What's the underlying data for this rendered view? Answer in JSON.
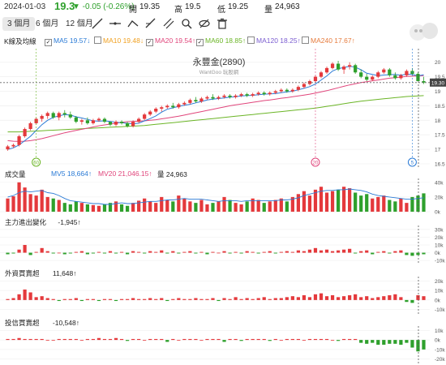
{
  "header": {
    "date": "2024-01-03",
    "price": "19.3",
    "change": "▼ -0.05 (-0.26%)",
    "open_label": "開",
    "open": "19.35",
    "high_label": "高",
    "high": "19.5",
    "low_label": "低",
    "low": "19.25",
    "vol_label": "量",
    "volume": "24,963"
  },
  "toolbar": {
    "ranges": [
      "3 個月",
      "6 個月",
      "12 個月"
    ],
    "active_range": "3 個月",
    "tools": [
      "line-tool-icon",
      "horizontal-line-icon",
      "polyline-icon",
      "measure-icon",
      "channel-icon",
      "zoom-icon",
      "eye-off-icon",
      "trash-icon"
    ]
  },
  "legend": {
    "title": "K線及均線",
    "items": [
      {
        "label": "MA5 19.57↓",
        "color": "#2b7bd6",
        "checked": true
      },
      {
        "label": "MA10 19.48↓",
        "color": "#f0a020",
        "checked": false
      },
      {
        "label": "MA20 19.54↑",
        "color": "#e0457b",
        "checked": true
      },
      {
        "label": "MA60 18.85↑",
        "color": "#6bb526",
        "checked": true
      },
      {
        "label": "MA120 18.25↑",
        "color": "#7a5cd0",
        "checked": false
      },
      {
        "label": "MA240 17.67↑",
        "color": "#e67b3c",
        "checked": false
      }
    ]
  },
  "main_chart": {
    "title": "永豐金(2890)",
    "subtitle": "WantGoo 玩股網",
    "y_ticks": [
      "20",
      "19.5",
      "19",
      "18.5",
      "18",
      "17.5",
      "17",
      "16.5"
    ],
    "last_price_tag": "19.30",
    "markers": [
      "60",
      "20",
      "5"
    ],
    "colors": {
      "up": "#e4393c",
      "down": "#2ea02c"
    }
  },
  "volume_panel": {
    "title": "成交量",
    "mv5": "MV5 18,664↑",
    "mv20": "MV20 21,046.15↑",
    "vol": "量 24,963",
    "y_ticks": [
      "40k",
      "20k",
      "0k"
    ]
  },
  "net_flow_panel": {
    "title": "主力進出變化",
    "value": "-1,945↑",
    "y_ticks": [
      "30k",
      "20k",
      "10k",
      "0k",
      "-10k"
    ]
  },
  "foreign_panel": {
    "title": "外資買賣超",
    "value": "11,648↑",
    "y_ticks": [
      "20k",
      "10k",
      "0k",
      "-10k"
    ]
  },
  "trust_panel": {
    "title": "投信買賣超",
    "value": "-10,548↑",
    "y_ticks": [
      "10k",
      "0k",
      "-10k",
      "-20k"
    ]
  },
  "chart_data": {
    "type": "candlestick",
    "candles": [
      [
        17.0,
        17.15,
        16.95,
        17.1
      ],
      [
        17.1,
        17.2,
        17.05,
        17.15
      ],
      [
        17.15,
        17.5,
        17.1,
        17.45
      ],
      [
        17.45,
        17.75,
        17.4,
        17.7
      ],
      [
        17.7,
        17.95,
        17.65,
        17.9
      ],
      [
        17.9,
        18.1,
        17.85,
        18.05
      ],
      [
        18.05,
        18.2,
        17.95,
        18.15
      ],
      [
        18.15,
        18.3,
        18.05,
        18.25
      ],
      [
        18.25,
        18.3,
        18.05,
        18.1
      ],
      [
        18.1,
        18.3,
        18.0,
        18.25
      ],
      [
        18.25,
        18.35,
        18.1,
        18.2
      ],
      [
        18.2,
        18.3,
        18.05,
        18.1
      ],
      [
        18.1,
        18.15,
        17.9,
        17.95
      ],
      [
        17.95,
        18.05,
        17.85,
        18.0
      ],
      [
        18.0,
        18.1,
        17.85,
        17.9
      ],
      [
        17.9,
        18.05,
        17.85,
        18.0
      ],
      [
        18.0,
        18.1,
        17.95,
        18.05
      ],
      [
        18.05,
        18.1,
        17.9,
        17.95
      ],
      [
        17.95,
        17.95,
        17.8,
        17.85
      ],
      [
        17.85,
        18.0,
        17.8,
        17.95
      ],
      [
        17.95,
        18.0,
        17.85,
        17.9
      ],
      [
        17.9,
        17.95,
        17.75,
        17.8
      ],
      [
        17.8,
        18.0,
        17.75,
        17.95
      ],
      [
        17.95,
        18.1,
        17.9,
        18.05
      ],
      [
        18.05,
        18.25,
        18.0,
        18.2
      ],
      [
        18.2,
        18.35,
        18.15,
        18.3
      ],
      [
        18.3,
        18.45,
        18.25,
        18.4
      ],
      [
        18.4,
        18.5,
        18.3,
        18.45
      ],
      [
        18.45,
        18.55,
        18.4,
        18.5
      ],
      [
        18.5,
        18.6,
        18.4,
        18.45
      ],
      [
        18.45,
        18.6,
        18.4,
        18.55
      ],
      [
        18.55,
        18.65,
        18.5,
        18.6
      ],
      [
        18.6,
        18.75,
        18.55,
        18.7
      ],
      [
        18.7,
        18.8,
        18.6,
        18.65
      ],
      [
        18.65,
        18.8,
        18.6,
        18.75
      ],
      [
        18.75,
        18.85,
        18.7,
        18.8
      ],
      [
        18.8,
        18.9,
        18.7,
        18.75
      ],
      [
        18.75,
        18.85,
        18.7,
        18.8
      ],
      [
        18.8,
        18.9,
        18.75,
        18.85
      ],
      [
        18.85,
        18.9,
        18.75,
        18.8
      ],
      [
        18.8,
        18.9,
        18.75,
        18.85
      ],
      [
        18.85,
        18.95,
        18.8,
        18.9
      ],
      [
        18.9,
        18.95,
        18.8,
        18.85
      ],
      [
        18.85,
        18.95,
        18.8,
        18.9
      ],
      [
        18.9,
        19.0,
        18.85,
        18.95
      ],
      [
        18.95,
        19.0,
        18.85,
        18.9
      ],
      [
        18.9,
        19.0,
        18.85,
        18.95
      ],
      [
        18.95,
        19.05,
        18.9,
        19.0
      ],
      [
        19.0,
        19.1,
        18.95,
        19.05
      ],
      [
        19.05,
        19.1,
        18.95,
        19.0
      ],
      [
        19.0,
        19.1,
        18.95,
        19.05
      ],
      [
        19.05,
        19.2,
        19.0,
        19.15
      ],
      [
        19.15,
        19.3,
        19.1,
        19.25
      ],
      [
        19.25,
        19.4,
        19.2,
        19.35
      ],
      [
        19.35,
        19.55,
        19.3,
        19.5
      ],
      [
        19.5,
        19.7,
        19.45,
        19.65
      ],
      [
        19.65,
        19.85,
        19.6,
        19.8
      ],
      [
        19.8,
        20.0,
        19.75,
        19.95
      ],
      [
        19.95,
        20.05,
        19.7,
        19.75
      ],
      [
        19.75,
        19.9,
        19.6,
        19.85
      ],
      [
        19.85,
        20.0,
        19.75,
        19.9
      ],
      [
        19.9,
        19.95,
        19.6,
        19.65
      ],
      [
        19.65,
        19.75,
        19.45,
        19.5
      ],
      [
        19.5,
        19.6,
        19.35,
        19.4
      ],
      [
        19.4,
        19.55,
        19.35,
        19.5
      ],
      [
        19.5,
        19.7,
        19.45,
        19.65
      ],
      [
        19.65,
        19.8,
        19.6,
        19.75
      ],
      [
        19.75,
        19.8,
        19.5,
        19.55
      ],
      [
        19.55,
        19.65,
        19.4,
        19.45
      ],
      [
        19.45,
        19.6,
        19.4,
        19.55
      ],
      [
        19.55,
        19.75,
        19.5,
        19.7
      ],
      [
        19.7,
        19.8,
        19.55,
        19.6
      ],
      [
        19.6,
        19.65,
        19.35,
        19.35
      ],
      [
        19.35,
        19.5,
        19.25,
        19.3
      ]
    ],
    "ma5": [
      17.0,
      17.05,
      17.15,
      17.3,
      17.45,
      17.65,
      17.85,
      18.0,
      18.1,
      18.15,
      18.2,
      18.18,
      18.12,
      18.08,
      18.03,
      17.98,
      17.97,
      17.98,
      17.96,
      17.93,
      17.92,
      17.89,
      17.88,
      17.9,
      17.98,
      18.06,
      18.15,
      18.28,
      18.38,
      18.43,
      18.48,
      18.52,
      18.55,
      18.6,
      18.65,
      18.7,
      18.73,
      18.75,
      18.77,
      18.8,
      18.81,
      18.84,
      18.85,
      18.86,
      18.88,
      18.9,
      18.91,
      18.92,
      18.95,
      18.98,
      19.0,
      19.05,
      19.1,
      19.16,
      19.25,
      19.39,
      19.53,
      19.7,
      19.78,
      19.82,
      19.86,
      19.83,
      19.74,
      19.62,
      19.58,
      19.54,
      19.56,
      19.57,
      19.58,
      19.55,
      19.59,
      19.58,
      19.53,
      19.57
    ],
    "ma20": [
      17.3,
      17.28,
      17.27,
      17.28,
      17.3,
      17.33,
      17.37,
      17.42,
      17.47,
      17.52,
      17.57,
      17.61,
      17.65,
      17.69,
      17.73,
      17.77,
      17.81,
      17.84,
      17.87,
      17.9,
      17.93,
      17.95,
      17.96,
      17.97,
      17.98,
      18.0,
      18.02,
      18.05,
      18.08,
      18.11,
      18.14,
      18.18,
      18.22,
      18.26,
      18.3,
      18.34,
      18.38,
      18.42,
      18.46,
      18.5,
      18.53,
      18.56,
      18.59,
      18.62,
      18.65,
      18.68,
      18.7,
      18.73,
      18.76,
      18.78,
      18.81,
      18.84,
      18.87,
      18.9,
      18.94,
      18.98,
      19.02,
      19.07,
      19.12,
      19.17,
      19.22,
      19.26,
      19.3,
      19.33,
      19.36,
      19.39,
      19.42,
      19.45,
      19.47,
      19.49,
      19.51,
      19.52,
      19.53,
      19.54
    ],
    "ma60": [
      17.6,
      17.6,
      17.6,
      17.61,
      17.62,
      17.63,
      17.64,
      17.65,
      17.66,
      17.67,
      17.68,
      17.69,
      17.7,
      17.71,
      17.72,
      17.73,
      17.74,
      17.75,
      17.76,
      17.77,
      17.78,
      17.79,
      17.8,
      17.81,
      17.82,
      17.84,
      17.86,
      17.88,
      17.9,
      17.92,
      17.94,
      17.96,
      17.98,
      18.0,
      18.02,
      18.04,
      18.06,
      18.08,
      18.1,
      18.12,
      18.14,
      18.16,
      18.18,
      18.2,
      18.22,
      18.24,
      18.26,
      18.28,
      18.3,
      18.32,
      18.34,
      18.36,
      18.38,
      18.4,
      18.42,
      18.45,
      18.48,
      18.51,
      18.54,
      18.57,
      18.6,
      18.63,
      18.66,
      18.68,
      18.7,
      18.72,
      18.74,
      18.76,
      18.78,
      18.8,
      18.82,
      18.83,
      18.84,
      18.85
    ],
    "volume": [
      18,
      21,
      40,
      33,
      24,
      22,
      30,
      20,
      18,
      16,
      12,
      10,
      14,
      12,
      10,
      9,
      8,
      10,
      12,
      14,
      10,
      8,
      12,
      15,
      18,
      14,
      12,
      20,
      16,
      14,
      22,
      18,
      14,
      12,
      16,
      10,
      12,
      14,
      20,
      16,
      12,
      10,
      14,
      18,
      16,
      12,
      14,
      16,
      18,
      14,
      20,
      24,
      28,
      22,
      30,
      34,
      26,
      28,
      30,
      34,
      32,
      26,
      22,
      24,
      18,
      20,
      22,
      16,
      14,
      18,
      12,
      20,
      22,
      25
    ],
    "mv5": [
      20,
      22,
      26,
      28,
      27,
      28,
      29,
      26,
      25,
      22,
      18,
      15,
      14,
      13,
      12,
      11,
      11,
      10,
      10,
      11,
      12,
      11,
      11,
      12,
      13,
      14,
      14,
      15,
      16,
      16,
      17,
      18,
      17,
      17,
      17,
      16,
      15,
      14,
      15,
      15,
      15,
      14,
      15,
      15,
      15,
      15,
      15,
      15,
      16,
      16,
      17,
      19,
      22,
      24,
      26,
      28,
      29,
      29,
      30,
      30,
      31,
      30,
      29,
      27,
      24,
      22,
      21,
      20,
      19,
      18,
      17,
      17,
      18,
      19
    ],
    "net": [
      -2,
      -1,
      4,
      10,
      -3,
      1,
      6,
      2,
      -1,
      0,
      -2,
      -1,
      1,
      2,
      -2,
      -1,
      1,
      -1,
      2,
      -1,
      1,
      -2,
      2,
      1,
      -1,
      2,
      1,
      3,
      -1,
      2,
      -1,
      1,
      2,
      -1,
      1,
      -2,
      1,
      0,
      2,
      -1,
      1,
      -1,
      2,
      1,
      -1,
      1,
      2,
      -1,
      1,
      2,
      1,
      3,
      2,
      4,
      6,
      3,
      4,
      2,
      3,
      4,
      5,
      -1,
      2,
      3,
      -2,
      1,
      2,
      -1,
      2,
      3,
      -3,
      -4,
      -3,
      -2
    ],
    "foreign": [
      1,
      2,
      6,
      11,
      8,
      3,
      4,
      2,
      1,
      -1,
      1,
      1,
      2,
      -1,
      1,
      1,
      -1,
      1,
      1,
      -1,
      1,
      1,
      2,
      1,
      1,
      2,
      1,
      2,
      -1,
      1,
      2,
      1,
      1,
      2,
      1,
      1,
      2,
      -1,
      2,
      1,
      3,
      1,
      2,
      1,
      2,
      3,
      1,
      2,
      2,
      3,
      4,
      3,
      5,
      3,
      6,
      7,
      4,
      5,
      3,
      4,
      5,
      6,
      3,
      4,
      2,
      3,
      4,
      5,
      6,
      3,
      -2,
      -3,
      5,
      4
    ],
    "trust": [
      1,
      1,
      2,
      1,
      1,
      1,
      1,
      0,
      0,
      1,
      1,
      1,
      1,
      0,
      1,
      1,
      2,
      1,
      1,
      2,
      1,
      -1,
      1,
      1,
      0,
      1,
      1,
      1,
      -2,
      1,
      0,
      1,
      1,
      1,
      0,
      1,
      1,
      1,
      -2,
      1,
      1,
      -1,
      1,
      1,
      1,
      1,
      -1,
      1,
      0,
      1,
      1,
      1,
      0,
      1,
      1,
      1,
      1,
      0,
      -1,
      1,
      1,
      1,
      -3,
      -4,
      -3,
      -5,
      -5,
      -4,
      -4,
      -5,
      -3,
      -8,
      -12,
      -10
    ]
  }
}
